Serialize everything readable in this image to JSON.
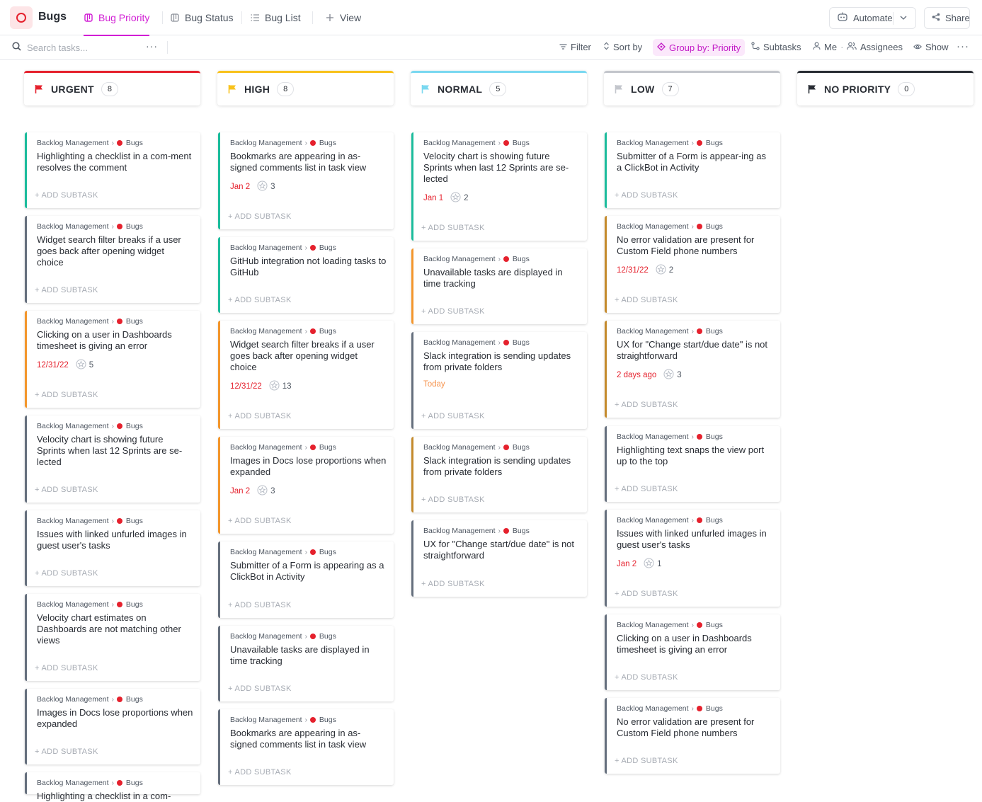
{
  "header": {
    "title": "Bugs",
    "tabs": [
      {
        "label": "Bug Priority",
        "icon": "board-icon",
        "active": true
      },
      {
        "label": "Bug Status",
        "icon": "board-icon"
      },
      {
        "label": "Bug List",
        "icon": "list-icon"
      },
      {
        "label": "View",
        "icon": "plus-icon"
      }
    ],
    "automate_label": "Automate",
    "share_label": "Share"
  },
  "toolbar": {
    "search_placeholder": "Search tasks...",
    "more": "···",
    "filter": "Filter",
    "sort": "Sort by",
    "group": "Group by: Priority",
    "subtasks": "Subtasks",
    "me": "Me",
    "assignees": "Assignees",
    "show": "Show",
    "overflow": "···"
  },
  "colors": {
    "urgent": "#e5212d",
    "high": "#f8c21c",
    "normal": "#7ad8f0",
    "low": "#c3c6cc",
    "no_priority": "#292d34",
    "accent": "#d11ed4"
  },
  "board": {
    "breadcrumb_list": "Backlog Management",
    "breadcrumb_space": "Bugs",
    "add_subtask_label": "+ ADD SUBTASK",
    "columns": [
      {
        "label": "URGENT",
        "count": "8",
        "flag_color": "#e5212d",
        "cards": [
          {
            "title": "Highlighting a checklist in a com-ment resolves the comment",
            "status_color": "#1bbc9c"
          },
          {
            "title": "Widget search filter breaks if a user goes back after opening widget choice",
            "status_color": "#656f7d"
          },
          {
            "title": "Clicking on a user in Dashboards timesheet is giving an error",
            "date": "12/31/22",
            "points": "5",
            "status_color": "#f3962c"
          },
          {
            "title": "Velocity chart is showing future Sprints when last 12 Sprints are se-lected",
            "status_color": "#656f7d"
          },
          {
            "title": "Issues with linked unfurled images in guest user's tasks",
            "status_color": "#656f7d"
          },
          {
            "title": "Velocity chart estimates on Dashboards are not matching other views",
            "status_color": "#656f7d"
          },
          {
            "title": "Images in Docs lose proportions when expanded",
            "status_color": "#656f7d"
          },
          {
            "title": "Highlighting a checklist in a com-",
            "status_color": "#656f7d"
          }
        ]
      },
      {
        "label": "HIGH",
        "count": "8",
        "flag_color": "#f8c21c",
        "cards": [
          {
            "title": "Bookmarks are appearing in as-signed comments list in task view",
            "date": "Jan 2",
            "points": "3",
            "status_color": "#1bbc9c"
          },
          {
            "title": "GitHub integration not loading tasks to GitHub",
            "status_color": "#1bbc9c"
          },
          {
            "title": "Widget search filter breaks if a user goes back after opening widget choice",
            "date": "12/31/22",
            "points": "13",
            "status_color": "#f3962c"
          },
          {
            "title": "Images in Docs lose proportions when expanded",
            "date": "Jan 2",
            "points": "3",
            "status_color": "#f3962c"
          },
          {
            "title": "Submitter of a Form is appearing as a ClickBot in Activity",
            "status_color": "#656f7d"
          },
          {
            "title": "Unavailable tasks are displayed in time tracking",
            "status_color": "#656f7d"
          },
          {
            "title": "Bookmarks are appearing in as-signed comments list in task view",
            "status_color": "#656f7d"
          }
        ]
      },
      {
        "label": "NORMAL",
        "count": "5",
        "flag_color": "#7ad8f0",
        "cards": [
          {
            "title": "Velocity chart is showing future Sprints when last 12 Sprints are se-lected",
            "date": "Jan 1",
            "points": "2",
            "status_color": "#1bbc9c"
          },
          {
            "title": "Unavailable tasks are displayed in time tracking",
            "status_color": "#f3962c"
          },
          {
            "title": "Slack integration is sending updates from private folders",
            "date": "Today",
            "today": true,
            "status_color": "#656f7d"
          },
          {
            "title": "Slack integration is sending updates from private folders",
            "status_color": "#c48a2c"
          },
          {
            "title": "UX for \"Change start/due date\" is not straightforward",
            "status_color": "#656f7d"
          }
        ]
      },
      {
        "label": "LOW",
        "count": "7",
        "flag_color": "#c3c6cc",
        "cards": [
          {
            "title": "Submitter of a Form is appear-ing as a ClickBot in Activity",
            "status_color": "#1bbc9c"
          },
          {
            "title": "No error validation are present for Custom Field phone numbers",
            "date": "12/31/22",
            "points": "2",
            "status_color": "#c48a2c"
          },
          {
            "title": "UX for \"Change start/due date\" is not straightforward",
            "date": "2 days ago",
            "points": "3",
            "status_color": "#c48a2c"
          },
          {
            "title": "Highlighting text snaps the view port up to the top",
            "status_color": "#656f7d"
          },
          {
            "title": "Issues with linked unfurled images in guest user's tasks",
            "date": "Jan 2",
            "points": "1",
            "status_color": "#656f7d"
          },
          {
            "title": "Clicking on a user in Dashboards timesheet is giving an error",
            "status_color": "#656f7d"
          },
          {
            "title": "No error validation are present for Custom Field phone numbers",
            "status_color": "#656f7d"
          }
        ]
      },
      {
        "label": "NO PRIORITY",
        "count": "0",
        "flag_color": "#292d34",
        "cards": []
      }
    ]
  }
}
